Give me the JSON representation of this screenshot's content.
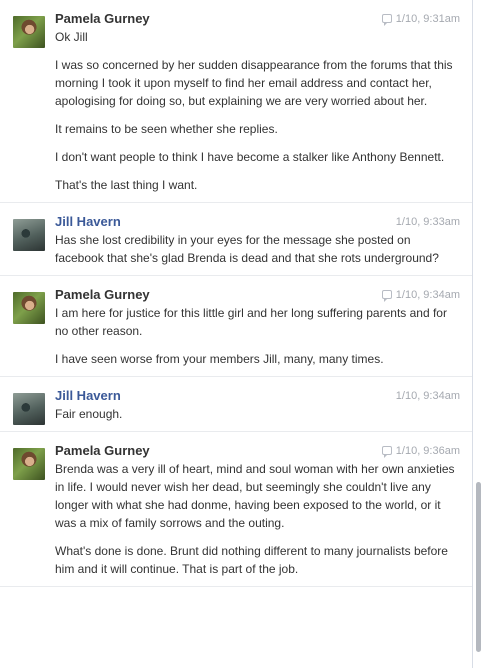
{
  "messages": [
    {
      "sender": "Pamela Gurney",
      "time": "1/10, 9:31am",
      "paragraphs": [
        "Ok Jill",
        "I was so concerned by her sudden disappearance from the forums that this morning I took it upon myself to find her email address and contact her, apologising for doing so, but explaining we are very worried about her.",
        "It remains to be seen whether she replies.",
        "I don't want people to think I have become a stalker like Anthony Bennett.",
        "That's the last thing I want."
      ]
    },
    {
      "sender": "Jill Havern",
      "time": "1/10, 9:33am",
      "paragraphs": [
        "Has she lost credibility in your eyes for the message she posted on facebook that she's glad Brenda is dead and that she rots underground?"
      ]
    },
    {
      "sender": "Pamela Gurney",
      "time": "1/10, 9:34am",
      "paragraphs": [
        "I am here for justice for this little girl and her long suffering parents and for no other reason.",
        "I have seen worse from your members Jill, many, many times."
      ]
    },
    {
      "sender": "Jill Havern",
      "time": "1/10, 9:34am",
      "paragraphs": [
        "Fair enough."
      ]
    },
    {
      "sender": "Pamela Gurney",
      "time": "1/10, 9:36am",
      "paragraphs": [
        "Brenda was a very ill of heart, mind and soul woman with her own anxieties in life.  I would never wish her dead, but seemingly she couldn't live any longer with what she had donme, having been exposed to the world, or it was a mix of family sorrows and the outing.",
        "What's done is done.  Brunt did nothing different to many journalists before him and it will continue.  That is part of the job."
      ]
    }
  ]
}
